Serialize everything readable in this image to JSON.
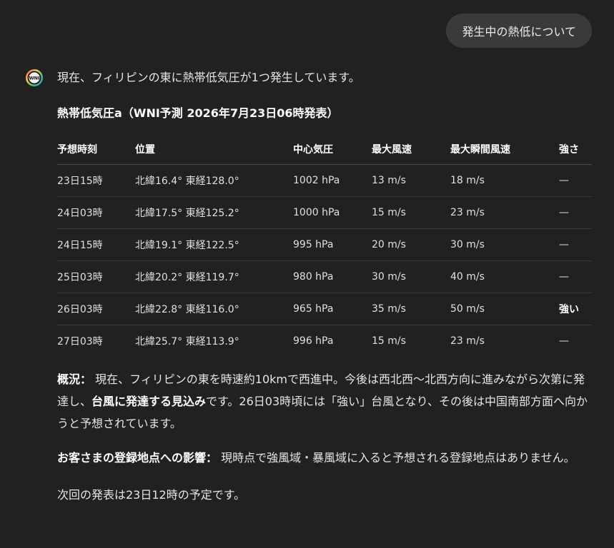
{
  "user_message": "発生中の熱低について",
  "assistant": {
    "avatar_text": "WNI",
    "intro": "現在、フィリピンの東に熱帯低気圧が1つ発生しています。",
    "heading": "熱帯低気圧a（WNI予測 2026年7月23日06時発表）",
    "table": {
      "headers": [
        "予想時刻",
        "位置",
        "中心気圧",
        "最大風速",
        "最大瞬間風速",
        "強さ"
      ],
      "rows": [
        [
          "23日15時",
          "北緯16.4° 東経128.0°",
          "1002 hPa",
          "13 m/s",
          "18 m/s",
          "—"
        ],
        [
          "24日03時",
          "北緯17.5° 東経125.2°",
          "1000 hPa",
          "15 m/s",
          "23 m/s",
          "—"
        ],
        [
          "24日15時",
          "北緯19.1° 東経122.5°",
          "995 hPa",
          "20 m/s",
          "30 m/s",
          "—"
        ],
        [
          "25日03時",
          "北緯20.2° 東経119.7°",
          "980 hPa",
          "30 m/s",
          "40 m/s",
          "—"
        ],
        [
          "26日03時",
          "北緯22.8° 東経116.0°",
          "965 hPa",
          "35 m/s",
          "50 m/s",
          "強い"
        ],
        [
          "27日03時",
          "北緯25.7° 東経113.9°",
          "996 hPa",
          "15 m/s",
          "23 m/s",
          "—"
        ]
      ]
    },
    "overview": {
      "label": "概況：",
      "text1": "現在、フィリピンの東を時速約10kmで西進中。今後は西北西〜北西方向に進みながら次第に発達し、",
      "emphasis": "台風に発達する見込み",
      "text2": "です。26日03時頃には「強い」台風となり、その後は中国南部方面へ向かうと予想されています。"
    },
    "impact": {
      "label": "お客さまの登録地点への影響：",
      "text": "現時点で強風域・暴風域に入ると予想される登録地点はありません。"
    },
    "next": "次回の発表は23日12時の予定です。"
  }
}
